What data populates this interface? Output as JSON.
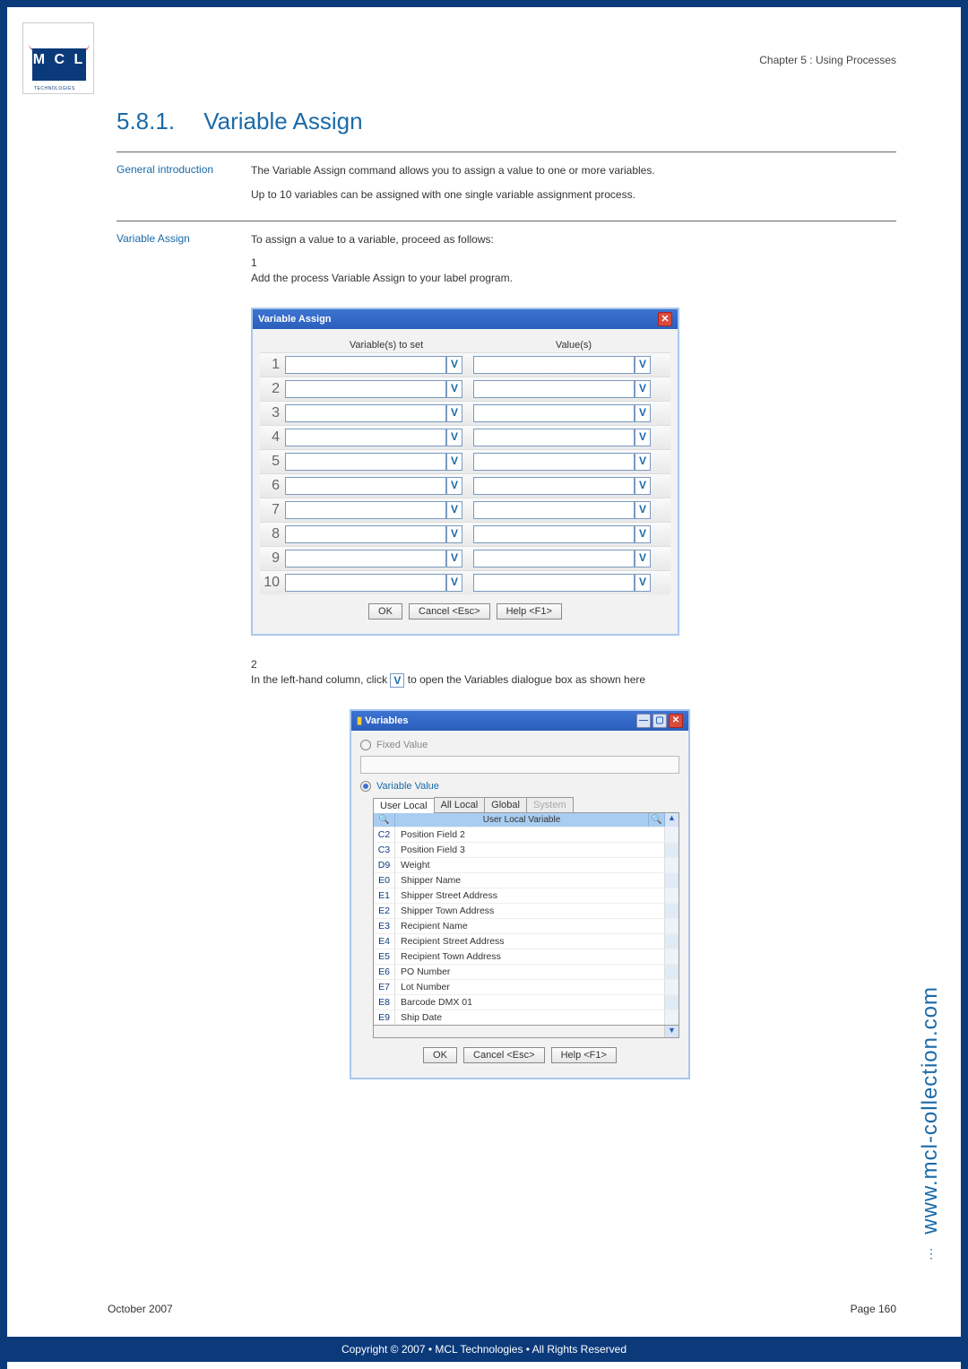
{
  "chapter": "Chapter 5 : Using Processes",
  "section": {
    "number": "5.8.1.",
    "title": "Variable Assign"
  },
  "general_intro": {
    "label": "General introduction",
    "p1": "The Variable Assign command allows you to assign a value to one or more variables.",
    "p2": "Up to 10 variables can be assigned with one single variable assignment process."
  },
  "variable_assign": {
    "label": "Variable Assign",
    "intro": "To assign a value to a variable, proceed as follows:",
    "step1_num": "1",
    "step1_txt": "Add the process Variable Assign to your label program.",
    "step2_num": "2",
    "step2_txt_a": "In the left-hand column, click ",
    "step2_txt_b": " to open the Variables dialogue box as shown here"
  },
  "dialog1": {
    "title": "Variable Assign",
    "col1": "Variable(s) to set",
    "col2": "Value(s)",
    "row_numbers": [
      "1",
      "2",
      "3",
      "4",
      "5",
      "6",
      "7",
      "8",
      "9",
      "10"
    ],
    "v_button": "V",
    "ok": "OK",
    "cancel": "Cancel <Esc>",
    "help": "Help <F1>"
  },
  "dialog2": {
    "title": "Variables",
    "fixed_label": "Fixed Value",
    "variable_label": "Variable Value",
    "tabs": {
      "user_local": "User Local",
      "all_local": "All Local",
      "global": "Global",
      "system": "System"
    },
    "col_header": "User Local Variable",
    "search_icon": "🔍",
    "vars": [
      {
        "id": "C2",
        "name": "Position Field 2"
      },
      {
        "id": "C3",
        "name": "Position Field 3"
      },
      {
        "id": "D9",
        "name": "Weight"
      },
      {
        "id": "E0",
        "name": "Shipper Name"
      },
      {
        "id": "E1",
        "name": "Shipper Street Address"
      },
      {
        "id": "E2",
        "name": "Shipper Town Address"
      },
      {
        "id": "E3",
        "name": "Recipient Name"
      },
      {
        "id": "E4",
        "name": "Recipient Street Address"
      },
      {
        "id": "E5",
        "name": "Recipient Town Address"
      },
      {
        "id": "E6",
        "name": "PO Number"
      },
      {
        "id": "E7",
        "name": "Lot Number"
      },
      {
        "id": "E8",
        "name": "Barcode DMX 01"
      },
      {
        "id": "E9",
        "name": "Ship Date"
      }
    ],
    "ok": "OK",
    "cancel": "Cancel <Esc>",
    "help": "Help <F1>"
  },
  "sidetext": "www.mcl-collection.com",
  "footer": {
    "date": "October 2007",
    "page": "Page 160"
  },
  "copyright": "Copyright © 2007 • MCL Technologies • All Rights Reserved",
  "logo": {
    "main": "M C L",
    "sub": "TECHNOLOGIES"
  }
}
